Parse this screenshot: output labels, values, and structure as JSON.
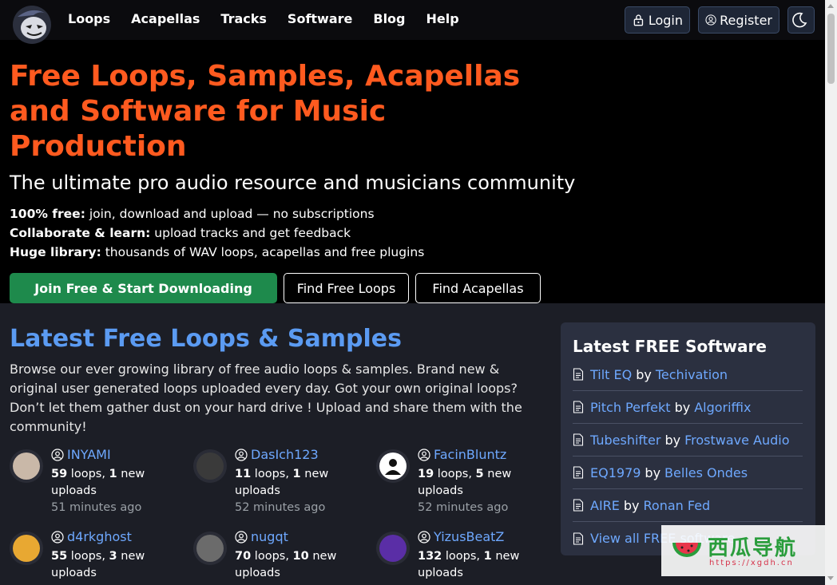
{
  "nav": {
    "links": [
      "Loops",
      "Acapellas",
      "Tracks",
      "Software",
      "Blog",
      "Help"
    ],
    "login": "Login",
    "register": "Register"
  },
  "hero": {
    "title": "Free Loops, Samples, Acapellas and Software for Music Production",
    "subtitle": "The ultimate pro audio resource and musicians community",
    "points": [
      {
        "bold": "100% free:",
        "text": " join, download and upload — no subscriptions"
      },
      {
        "bold": "Collaborate & learn:",
        "text": " upload tracks and get feedback"
      },
      {
        "bold": "Huge library:",
        "text": " thousands of WAV loops, acapellas and free plugins"
      }
    ],
    "btn_join": "Join Free & Start Downloading",
    "btn_loops": "Find Free Loops",
    "btn_acapellas": "Find Acapellas"
  },
  "latest": {
    "title": "Latest Free Loops & Samples",
    "description": "Browse our ever growing library of free audio loops & samples. Brand new & original user generated loops uploaded every day. Got your own original loops? Don’t let them gather dust on your hard drive ! Upload and share them with the community!",
    "users": [
      {
        "name": "INYAMI",
        "loops": "59",
        "new": "1",
        "time": "51 minutes ago",
        "avatar_color": "#c9b8a8"
      },
      {
        "name": "DasIch123",
        "loops": "11",
        "new": "1",
        "time": "52 minutes ago",
        "avatar_color": "#3a3a3a"
      },
      {
        "name": "FacinBluntz",
        "loops": "19",
        "new": "5",
        "time": "52 minutes ago",
        "avatar_color": "#ffffff"
      },
      {
        "name": "d4rkghost",
        "loops": "55",
        "new": "3",
        "time": "",
        "avatar_color": "#e8a832"
      },
      {
        "name": "nugqt",
        "loops": "70",
        "new": "10",
        "time": "",
        "avatar_color": "#6b6b6b"
      },
      {
        "name": "YizusBeatZ",
        "loops": "132",
        "new": "1",
        "time": "",
        "avatar_color": "#5a2ea6"
      }
    ],
    "loops_word": " loops, ",
    "new_word": " new",
    "uploads_word": "uploads"
  },
  "software": {
    "title": "Latest FREE Software",
    "items": [
      {
        "name": "Tilt EQ",
        "by": "by",
        "maker": "Techivation"
      },
      {
        "name": "Pitch Perfekt",
        "by": "by",
        "maker": "Algoriffix"
      },
      {
        "name": "Tubeshifter",
        "by": "by",
        "maker": "Frostwave Audio"
      },
      {
        "name": "EQ1979",
        "by": "by",
        "maker": "Belles Ondes"
      },
      {
        "name": "AIRE",
        "by": "by",
        "maker": "Ronan Fed"
      }
    ],
    "view_all": "View all FREE software"
  },
  "watermark": {
    "text": "西瓜导航",
    "url": "https://xgdh.cn"
  }
}
